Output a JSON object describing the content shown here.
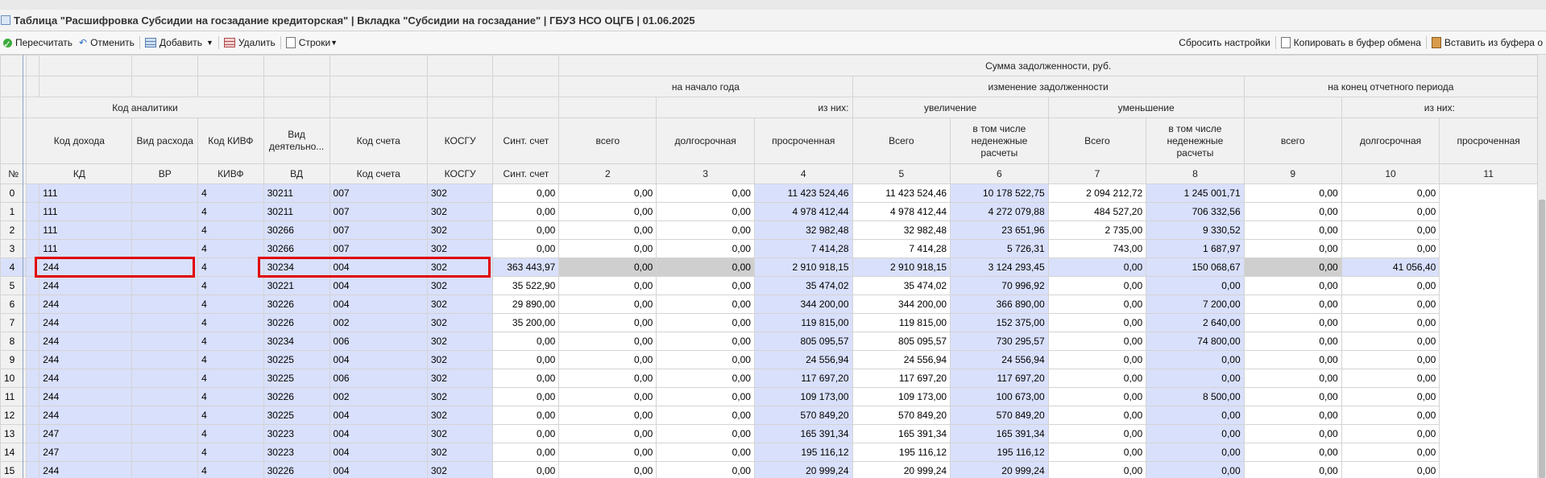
{
  "title": "Таблица \"Расшифровка Субсидии на госзадание кредиторская\" | Вкладка \"Субсидии на госзадание\" | ГБУЗ НСО ОЦГБ | 01.06.2025",
  "toolbar": {
    "recalc": "Пересчитать",
    "undo": "Отменить",
    "add": "Добавить",
    "delete": "Удалить",
    "rows": "Строки",
    "reset": "Сбросить настройки",
    "copy": "Копировать в буфер обмена",
    "paste": "Вставить из буфера о"
  },
  "header": {
    "sum_total": "Сумма задолженности, руб.",
    "start_year": "на начало года",
    "change": "изменение задолженности",
    "end_period": "на конец отчетного периода",
    "analytics_code": "Код аналитики",
    "of_them": "из них:",
    "increase": "увеличение",
    "decrease": "уменьшение",
    "c_income": "Код дохода",
    "c_exp": "Вид расхода",
    "c_kivf": "Код КИВФ",
    "c_vd": "Вид деятельно...",
    "c_acc": "Код счета",
    "c_kosgu": "КОСГУ",
    "c_synt": "Синт. счет",
    "c_total": "всего",
    "c_long": "долгосрочная",
    "c_overdue": "просроченная",
    "c_inc_total": "Всего",
    "c_inc_nonmon": "в том числе неденежные расчеты",
    "c_dec_total": "Всего",
    "c_dec_nonmon": "в том числе неденежные расчеты",
    "c_end_total": "всего",
    "c_end_long": "долгосрочная",
    "c_end_overdue": "просроченная",
    "n_no": "№",
    "n_kd": "КД",
    "n_vr": "ВР",
    "n_kivf": "КИВФ",
    "n_vd": "ВД",
    "n_acc": "Код счета",
    "n_kosgu": "КОСГУ",
    "n_synt": "Синт. счет",
    "n2": "2",
    "n3": "3",
    "n4": "4",
    "n5": "5",
    "n6": "6",
    "n7": "7",
    "n8": "8",
    "n9": "9",
    "n10": "10",
    "n11": "11"
  },
  "rows": [
    [
      "0",
      "",
      "111",
      "",
      "4",
      "30211",
      "007",
      "302",
      "0,00",
      "0,00",
      "0,00",
      "11 423 524,46",
      "11 423 524,46",
      "10 178 522,75",
      "2 094 212,72",
      "1 245 001,71",
      "0,00",
      "0,00"
    ],
    [
      "1",
      "",
      "111",
      "",
      "4",
      "30211",
      "007",
      "302",
      "0,00",
      "0,00",
      "0,00",
      "4 978 412,44",
      "4 978 412,44",
      "4 272 079,88",
      "484 527,20",
      "706 332,56",
      "0,00",
      "0,00"
    ],
    [
      "2",
      "",
      "111",
      "",
      "4",
      "30266",
      "007",
      "302",
      "0,00",
      "0,00",
      "0,00",
      "32 982,48",
      "32 982,48",
      "23 651,96",
      "2 735,00",
      "9 330,52",
      "0,00",
      "0,00"
    ],
    [
      "3",
      "",
      "111",
      "",
      "4",
      "30266",
      "007",
      "302",
      "0,00",
      "0,00",
      "0,00",
      "7 414,28",
      "7 414,28",
      "5 726,31",
      "743,00",
      "1 687,97",
      "0,00",
      "0,00"
    ],
    [
      "4",
      "",
      "244",
      "",
      "4",
      "30234",
      "004",
      "302",
      "363 443,97",
      "0,00",
      "0,00",
      "2 910 918,15",
      "2 910 918,15",
      "3 124 293,45",
      "0,00",
      "150 068,67",
      "0,00",
      "41 056,40"
    ],
    [
      "5",
      "",
      "244",
      "",
      "4",
      "30221",
      "004",
      "302",
      "35 522,90",
      "0,00",
      "0,00",
      "35 474,02",
      "35 474,02",
      "70 996,92",
      "0,00",
      "0,00",
      "0,00",
      "0,00"
    ],
    [
      "6",
      "",
      "244",
      "",
      "4",
      "30226",
      "004",
      "302",
      "29 890,00",
      "0,00",
      "0,00",
      "344 200,00",
      "344 200,00",
      "366 890,00",
      "0,00",
      "7 200,00",
      "0,00",
      "0,00"
    ],
    [
      "7",
      "",
      "244",
      "",
      "4",
      "30226",
      "002",
      "302",
      "35 200,00",
      "0,00",
      "0,00",
      "119 815,00",
      "119 815,00",
      "152 375,00",
      "0,00",
      "2 640,00",
      "0,00",
      "0,00"
    ],
    [
      "8",
      "",
      "244",
      "",
      "4",
      "30234",
      "006",
      "302",
      "0,00",
      "0,00",
      "0,00",
      "805 095,57",
      "805 095,57",
      "730 295,57",
      "0,00",
      "74 800,00",
      "0,00",
      "0,00"
    ],
    [
      "9",
      "",
      "244",
      "",
      "4",
      "30225",
      "004",
      "302",
      "0,00",
      "0,00",
      "0,00",
      "24 556,94",
      "24 556,94",
      "24 556,94",
      "0,00",
      "0,00",
      "0,00",
      "0,00"
    ],
    [
      "10",
      "",
      "244",
      "",
      "4",
      "30225",
      "006",
      "302",
      "0,00",
      "0,00",
      "0,00",
      "117 697,20",
      "117 697,20",
      "117 697,20",
      "0,00",
      "0,00",
      "0,00",
      "0,00"
    ],
    [
      "11",
      "",
      "244",
      "",
      "4",
      "30226",
      "002",
      "302",
      "0,00",
      "0,00",
      "0,00",
      "109 173,00",
      "109 173,00",
      "100 673,00",
      "0,00",
      "8 500,00",
      "0,00",
      "0,00"
    ],
    [
      "12",
      "",
      "244",
      "",
      "4",
      "30225",
      "004",
      "302",
      "0,00",
      "0,00",
      "0,00",
      "570 849,20",
      "570 849,20",
      "570 849,20",
      "0,00",
      "0,00",
      "0,00",
      "0,00"
    ],
    [
      "13",
      "",
      "247",
      "",
      "4",
      "30223",
      "004",
      "302",
      "0,00",
      "0,00",
      "0,00",
      "165 391,34",
      "165 391,34",
      "165 391,34",
      "0,00",
      "0,00",
      "0,00",
      "0,00"
    ],
    [
      "14",
      "",
      "247",
      "",
      "4",
      "30223",
      "004",
      "302",
      "0,00",
      "0,00",
      "0,00",
      "195 116,12",
      "195 116,12",
      "195 116,12",
      "0,00",
      "0,00",
      "0,00",
      "0,00"
    ],
    [
      "15",
      "",
      "244",
      "",
      "4",
      "30226",
      "004",
      "302",
      "0,00",
      "0,00",
      "0,00",
      "20 999,24",
      "20 999,24",
      "20 999,24",
      "0,00",
      "0,00",
      "0,00",
      "0,00"
    ]
  ],
  "selected_row": 4,
  "colors": {
    "row_blue": "#d9e0fb",
    "highlight": "#e10000",
    "gray_cell": "#cfcfcf"
  }
}
